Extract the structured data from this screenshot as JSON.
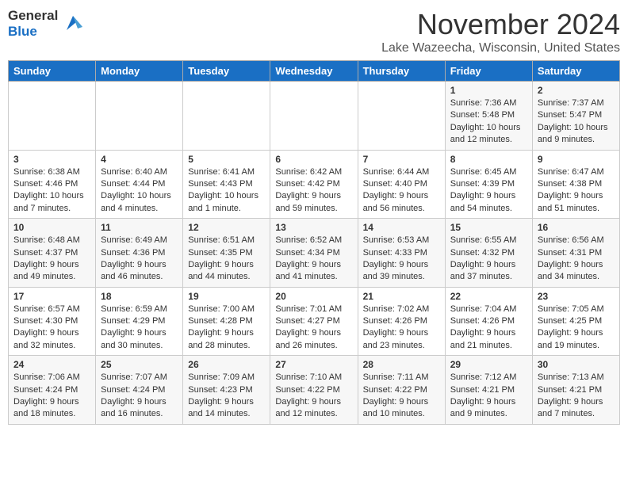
{
  "header": {
    "logo_general": "General",
    "logo_blue": "Blue",
    "month_title": "November 2024",
    "location": "Lake Wazeecha, Wisconsin, United States"
  },
  "days_of_week": [
    "Sunday",
    "Monday",
    "Tuesday",
    "Wednesday",
    "Thursday",
    "Friday",
    "Saturday"
  ],
  "weeks": [
    {
      "days": [
        {
          "num": "",
          "info": ""
        },
        {
          "num": "",
          "info": ""
        },
        {
          "num": "",
          "info": ""
        },
        {
          "num": "",
          "info": ""
        },
        {
          "num": "",
          "info": ""
        },
        {
          "num": "1",
          "info": "Sunrise: 7:36 AM\nSunset: 5:48 PM\nDaylight: 10 hours and 12 minutes."
        },
        {
          "num": "2",
          "info": "Sunrise: 7:37 AM\nSunset: 5:47 PM\nDaylight: 10 hours and 9 minutes."
        }
      ]
    },
    {
      "days": [
        {
          "num": "3",
          "info": "Sunrise: 6:38 AM\nSunset: 4:46 PM\nDaylight: 10 hours and 7 minutes."
        },
        {
          "num": "4",
          "info": "Sunrise: 6:40 AM\nSunset: 4:44 PM\nDaylight: 10 hours and 4 minutes."
        },
        {
          "num": "5",
          "info": "Sunrise: 6:41 AM\nSunset: 4:43 PM\nDaylight: 10 hours and 1 minute."
        },
        {
          "num": "6",
          "info": "Sunrise: 6:42 AM\nSunset: 4:42 PM\nDaylight: 9 hours and 59 minutes."
        },
        {
          "num": "7",
          "info": "Sunrise: 6:44 AM\nSunset: 4:40 PM\nDaylight: 9 hours and 56 minutes."
        },
        {
          "num": "8",
          "info": "Sunrise: 6:45 AM\nSunset: 4:39 PM\nDaylight: 9 hours and 54 minutes."
        },
        {
          "num": "9",
          "info": "Sunrise: 6:47 AM\nSunset: 4:38 PM\nDaylight: 9 hours and 51 minutes."
        }
      ]
    },
    {
      "days": [
        {
          "num": "10",
          "info": "Sunrise: 6:48 AM\nSunset: 4:37 PM\nDaylight: 9 hours and 49 minutes."
        },
        {
          "num": "11",
          "info": "Sunrise: 6:49 AM\nSunset: 4:36 PM\nDaylight: 9 hours and 46 minutes."
        },
        {
          "num": "12",
          "info": "Sunrise: 6:51 AM\nSunset: 4:35 PM\nDaylight: 9 hours and 44 minutes."
        },
        {
          "num": "13",
          "info": "Sunrise: 6:52 AM\nSunset: 4:34 PM\nDaylight: 9 hours and 41 minutes."
        },
        {
          "num": "14",
          "info": "Sunrise: 6:53 AM\nSunset: 4:33 PM\nDaylight: 9 hours and 39 minutes."
        },
        {
          "num": "15",
          "info": "Sunrise: 6:55 AM\nSunset: 4:32 PM\nDaylight: 9 hours and 37 minutes."
        },
        {
          "num": "16",
          "info": "Sunrise: 6:56 AM\nSunset: 4:31 PM\nDaylight: 9 hours and 34 minutes."
        }
      ]
    },
    {
      "days": [
        {
          "num": "17",
          "info": "Sunrise: 6:57 AM\nSunset: 4:30 PM\nDaylight: 9 hours and 32 minutes."
        },
        {
          "num": "18",
          "info": "Sunrise: 6:59 AM\nSunset: 4:29 PM\nDaylight: 9 hours and 30 minutes."
        },
        {
          "num": "19",
          "info": "Sunrise: 7:00 AM\nSunset: 4:28 PM\nDaylight: 9 hours and 28 minutes."
        },
        {
          "num": "20",
          "info": "Sunrise: 7:01 AM\nSunset: 4:27 PM\nDaylight: 9 hours and 26 minutes."
        },
        {
          "num": "21",
          "info": "Sunrise: 7:02 AM\nSunset: 4:26 PM\nDaylight: 9 hours and 23 minutes."
        },
        {
          "num": "22",
          "info": "Sunrise: 7:04 AM\nSunset: 4:26 PM\nDaylight: 9 hours and 21 minutes."
        },
        {
          "num": "23",
          "info": "Sunrise: 7:05 AM\nSunset: 4:25 PM\nDaylight: 9 hours and 19 minutes."
        }
      ]
    },
    {
      "days": [
        {
          "num": "24",
          "info": "Sunrise: 7:06 AM\nSunset: 4:24 PM\nDaylight: 9 hours and 18 minutes."
        },
        {
          "num": "25",
          "info": "Sunrise: 7:07 AM\nSunset: 4:24 PM\nDaylight: 9 hours and 16 minutes."
        },
        {
          "num": "26",
          "info": "Sunrise: 7:09 AM\nSunset: 4:23 PM\nDaylight: 9 hours and 14 minutes."
        },
        {
          "num": "27",
          "info": "Sunrise: 7:10 AM\nSunset: 4:22 PM\nDaylight: 9 hours and 12 minutes."
        },
        {
          "num": "28",
          "info": "Sunrise: 7:11 AM\nSunset: 4:22 PM\nDaylight: 9 hours and 10 minutes."
        },
        {
          "num": "29",
          "info": "Sunrise: 7:12 AM\nSunset: 4:21 PM\nDaylight: 9 hours and 9 minutes."
        },
        {
          "num": "30",
          "info": "Sunrise: 7:13 AM\nSunset: 4:21 PM\nDaylight: 9 hours and 7 minutes."
        }
      ]
    }
  ]
}
